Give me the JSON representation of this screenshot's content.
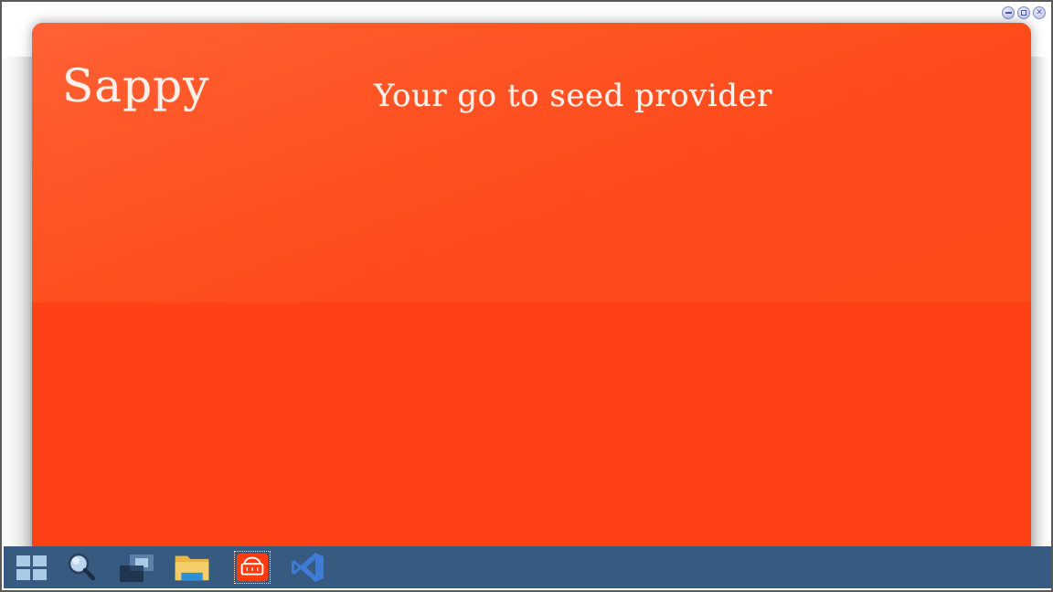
{
  "app": {
    "title": "Sappy",
    "tagline": "Your go to seed provider"
  },
  "window_controls": {
    "icons": [
      "minimize-icon",
      "maximize-icon",
      "close-icon"
    ]
  },
  "taskbar": {
    "items": [
      {
        "icon": "windows-start-icon"
      },
      {
        "icon": "search-icon"
      },
      {
        "icon": "task-view-icon"
      },
      {
        "icon": "file-explorer-icon"
      },
      {
        "icon": "store-icon",
        "active": true
      },
      {
        "icon": "visual-studio-code-icon"
      }
    ]
  },
  "colors": {
    "app_background": "#ff4115",
    "header_gradient_top": "#ff6136",
    "title_text": "#fff1ea",
    "taskbar": "#365a80"
  }
}
